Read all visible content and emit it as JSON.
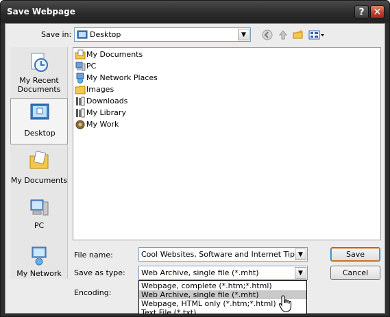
{
  "window": {
    "title": "Save Webpage",
    "help_label": "?",
    "close_label": "✕"
  },
  "save_in": {
    "label": "Save in:",
    "value": "Desktop"
  },
  "places": [
    {
      "label": "My Recent Documents",
      "icon": "recent-documents-icon"
    },
    {
      "label": "Desktop",
      "icon": "desktop-icon"
    },
    {
      "label": "My Documents",
      "icon": "my-documents-icon"
    },
    {
      "label": "PC",
      "icon": "computer-icon"
    },
    {
      "label": "My Network",
      "icon": "network-icon"
    }
  ],
  "files": [
    {
      "name": "My Documents",
      "icon": "my-documents-icon"
    },
    {
      "name": "PC",
      "icon": "computer-icon"
    },
    {
      "name": "My Network Places",
      "icon": "network-places-icon"
    },
    {
      "name": "Images",
      "icon": "folder-icon"
    },
    {
      "name": "Downloads",
      "icon": "library-icon"
    },
    {
      "name": "My Library",
      "icon": "library-icon"
    },
    {
      "name": "My Work",
      "icon": "work-icon"
    }
  ],
  "form": {
    "filename_label": "File name:",
    "filename_value": "Cool Websites, Software and Internet Tips",
    "savetype_label": "Save as type:",
    "savetype_value": "Web Archive, single file (*.mht)",
    "encoding_label": "Encoding:"
  },
  "buttons": {
    "save": "Save",
    "cancel": "Cancel"
  },
  "type_options": [
    "Webpage, complete (*.htm;*.html)",
    "Web Archive, single file (*.mht)",
    "Webpage, HTML only (*.htm;*.html)",
    "Text File (*.txt)"
  ],
  "colors": {
    "title_bar": "#2b2b2b",
    "close": "#c1402a",
    "highlight": "#c9c9c9"
  }
}
